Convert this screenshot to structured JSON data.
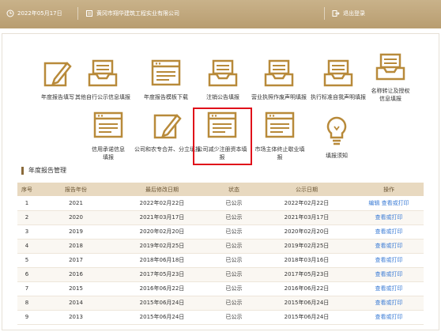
{
  "header": {
    "date": "2022年05月17日",
    "company": "黄冈市翔华建筑工程实业有限公司",
    "logout": "退出登录"
  },
  "tiles": [
    {
      "label": "年度报告填写",
      "icon": "pencil-form-icon"
    },
    {
      "label": "其他自行公示信息填报",
      "icon": "inbox-tray-icon"
    },
    {
      "label": "年度报告模板下载",
      "icon": "document-window-icon"
    },
    {
      "label": "注销公告填报",
      "icon": "inbox-tray-icon"
    },
    {
      "label": "营业执照作废声明填报",
      "icon": "inbox-tray-icon"
    },
    {
      "label": "执行标准自我声明填报",
      "icon": "inbox-tray-icon"
    },
    {
      "label": "名称转让及授权信息填报",
      "icon": "inbox-tray-icon"
    },
    {
      "label": "信用承诺信息填报",
      "icon": "document-window-icon"
    },
    {
      "label": "公司和农专合并、分立填报",
      "icon": "pencil-form-icon"
    },
    {
      "label": "公司减少注册资本填报",
      "icon": "document-window-icon"
    },
    {
      "label": "市场主体终止歇业填报",
      "icon": "document-window-icon"
    },
    {
      "label": "填报须知",
      "icon": "lightbulb-icon"
    }
  ],
  "section_title": "年度报告管理",
  "table": {
    "headers": [
      "序号",
      "报告年份",
      "最后修改日期",
      "状态",
      "公示日期",
      "操作"
    ],
    "rows": [
      [
        "1",
        "2021",
        "2022年02月22日",
        "已公示",
        "2022年02月22日",
        "编辑  查看或打印"
      ],
      [
        "2",
        "2020",
        "2021年03月17日",
        "已公示",
        "2021年03月17日",
        "查看或打印"
      ],
      [
        "3",
        "2019",
        "2020年02月20日",
        "已公示",
        "2020年02月20日",
        "查看或打印"
      ],
      [
        "4",
        "2018",
        "2019年02月25日",
        "已公示",
        "2019年02月25日",
        "查看或打印"
      ],
      [
        "5",
        "2017",
        "2018年06月18日",
        "已公示",
        "2018年03月16日",
        "查看或打印"
      ],
      [
        "6",
        "2016",
        "2017年05月23日",
        "已公示",
        "2017年05月23日",
        "查看或打印"
      ],
      [
        "7",
        "2015",
        "2016年06月22日",
        "已公示",
        "2016年06月22日",
        "查看或打印"
      ],
      [
        "8",
        "2014",
        "2015年06月24日",
        "已公示",
        "2015年06月24日",
        "查看或打印"
      ],
      [
        "9",
        "2013",
        "2015年06月24日",
        "已公示",
        "2015年06月24日",
        "查看或打印"
      ]
    ]
  },
  "colors": {
    "accent": "#b89d70",
    "icon": "#b88a3a",
    "link": "#3a7bd5",
    "highlight": "#e0101a"
  }
}
